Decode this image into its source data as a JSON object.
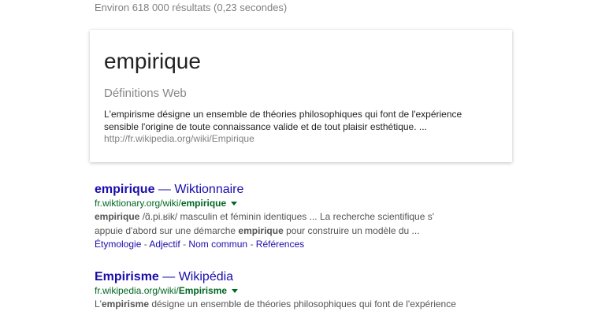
{
  "search": {
    "stats": "Environ 618 000 résultats (0,23 secondes)"
  },
  "definition_card": {
    "term": "empirique",
    "source_title": "Définitions Web",
    "definition": "L'empirisme désigne un ensemble de théories philosophiques qui font de l'expérience sensible l'origine de toute connaissance valide et de tout plaisir esthétique. ...",
    "url": "http://fr.wikipedia.org/wiki/Empirique"
  },
  "results": [
    {
      "title_bold": "empirique",
      "title_rest": " — Wiktionnaire",
      "cite_prefix": "fr.wiktionary.org/wiki/",
      "cite_bold": "empirique",
      "snippet_line1_bold": "empirique",
      "snippet_line1_rest": " /ɑ̃.pi.ʁik/ masculin et féminin identiques ... La recherche scientifique s'",
      "snippet_line2_pre": "appuie d'abord sur une démarche ",
      "snippet_line2_bold": "empirique",
      "snippet_line2_post": " pour construire un modèle du ...",
      "sitelinks": [
        "Étymologie",
        "Adjectif",
        "Nom commun",
        "Références"
      ],
      "sitelink_separator": " - "
    },
    {
      "title_bold": "Empirisme",
      "title_rest": " — Wikipédia",
      "cite_prefix": "fr.wikipedia.org/wiki/",
      "cite_bold": "Empirisme",
      "snippet_line1_pre": "L'",
      "snippet_line1_bold": "empirisme",
      "snippet_line1_post": " désigne un ensemble de théories philosophiques qui font de l'expérience"
    }
  ],
  "colors": {
    "link": "#1a0dab",
    "url_green": "#006621",
    "snippet": "#545454",
    "meta_gray": "#808080"
  }
}
